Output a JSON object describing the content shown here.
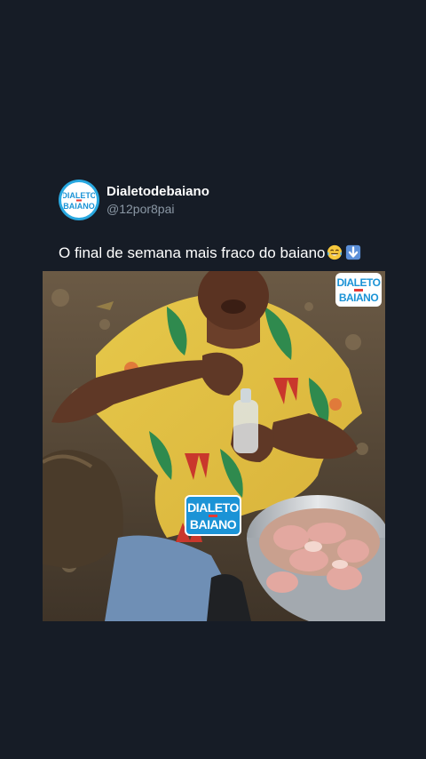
{
  "post": {
    "display_name": "Dialetodebaiano",
    "handle": "@12por8pai",
    "text": "O final de semana mais fraco do baiano",
    "emojis": [
      "face-with-tears-of-joy",
      "down-arrow"
    ]
  },
  "avatar": {
    "logo_line1": "DIALETO",
    "logo_line2": "BAIANO"
  },
  "watermarks": {
    "line1": "DIALETO",
    "line2": "BAIANO"
  },
  "colors": {
    "background": "#161c26",
    "text_primary": "#ffffff",
    "text_secondary": "#8b98a5",
    "brand_blue": "#1b93d6",
    "brand_red": "#e53935"
  }
}
